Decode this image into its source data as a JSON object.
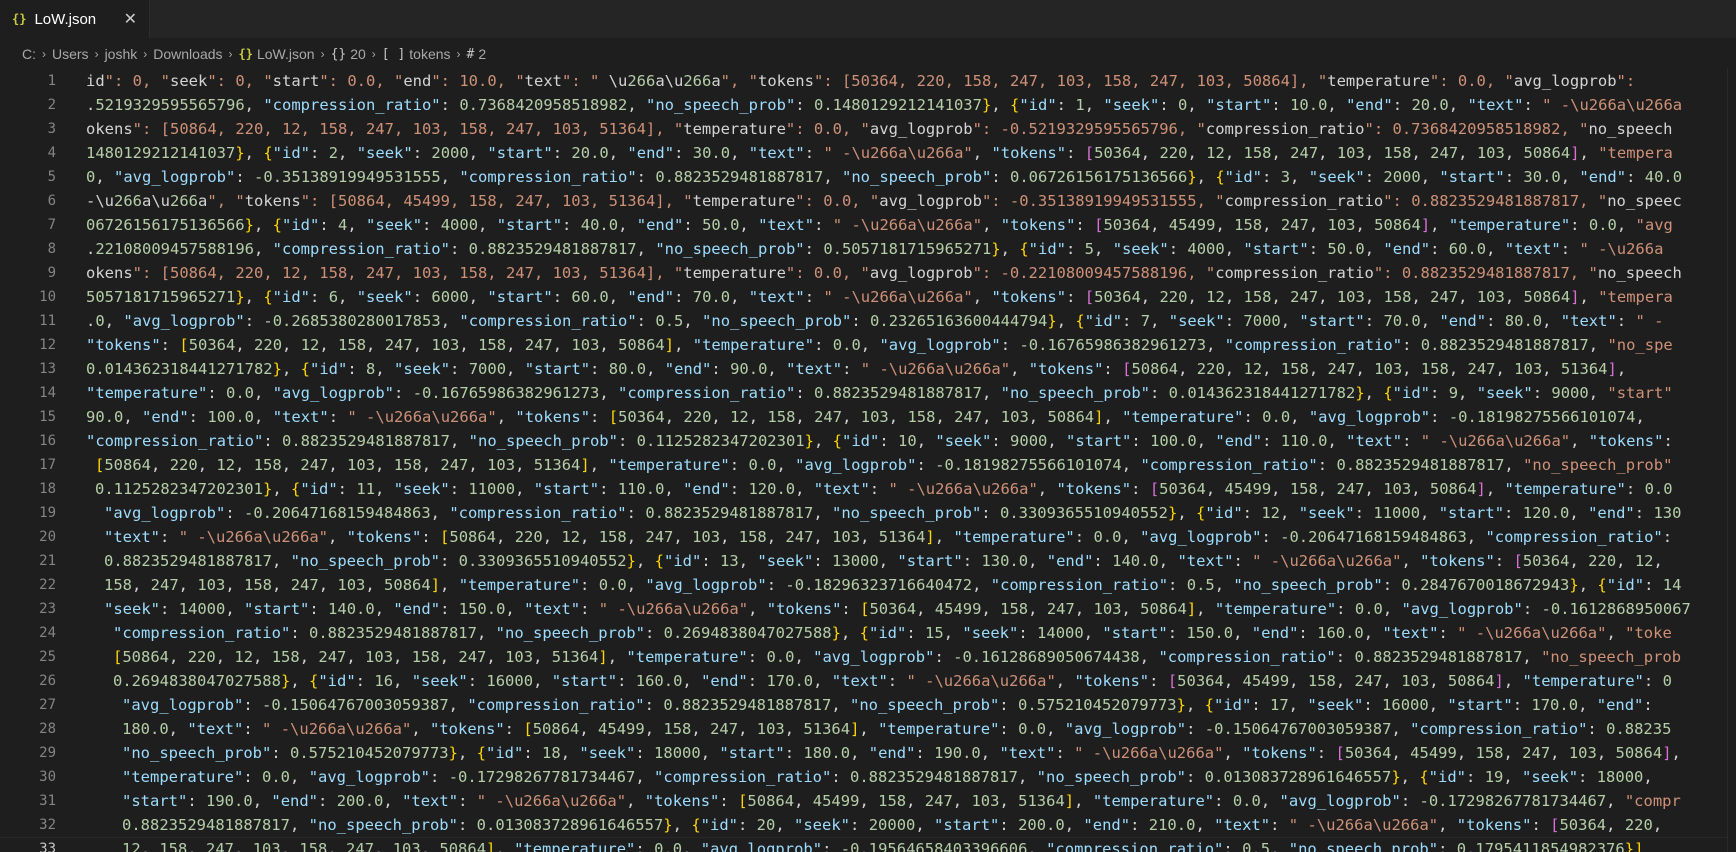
{
  "tab": {
    "label": "LoW.json",
    "icon": "json-braces-icon",
    "close_glyph": "✕"
  },
  "breadcrumb": [
    {
      "label": "C:"
    },
    {
      "label": "Users"
    },
    {
      "label": "joshk"
    },
    {
      "label": "Downloads"
    },
    {
      "label": "LoW.json",
      "icon": "{}"
    },
    {
      "label": "20",
      "icon": "{}"
    },
    {
      "label": "tokens",
      "icon": "[ ]"
    },
    {
      "label": "2",
      "icon": "#"
    }
  ],
  "colors": {
    "key": "#9cdcfe",
    "string": "#ce9178",
    "number": "#b5cea8",
    "bracket1": "#ffd700",
    "bracket2": "#da70d6",
    "bracket3": "#179fff"
  },
  "active_line": 33,
  "lines": [
    {
      "n": "1",
      "i": 0,
      "t": "id\": 0, \"seek\": 0, \"start\": 0.0, \"end\": 10.0, \"text\": \" \\u266a\\u266a\", \"tokens\": [50364, 220, 158, 247, 103, 158, 247, 103, 50864], \"temperature\": 0.0, \"avg_logprob\":"
    },
    {
      "n": "2",
      "i": 0,
      "t": ".5219329595565796, \"compression_ratio\": 0.7368420958518982, \"no_speech_prob\": 0.1480129212141037}, {\"id\": 1, \"seek\": 0, \"start\": 10.0, \"end\": 20.0, \"text\": \" -\\u266a\\u266a"
    },
    {
      "n": "3",
      "i": 0,
      "t": "okens\": [50864, 220, 12, 158, 247, 103, 158, 247, 103, 51364], \"temperature\": 0.0, \"avg_logprob\": -0.5219329595565796, \"compression_ratio\": 0.7368420958518982, \"no_speech"
    },
    {
      "n": "4",
      "i": 0,
      "t": "1480129212141037}, {\"id\": 2, \"seek\": 2000, \"start\": 20.0, \"end\": 30.0, \"text\": \" -\\u266a\\u266a\", \"tokens\": [50364, 220, 12, 158, 247, 103, 158, 247, 103, 50864], \"tempera"
    },
    {
      "n": "5",
      "i": 0,
      "t": "0, \"avg_logprob\": -0.35138919949531555, \"compression_ratio\": 0.8823529481887817, \"no_speech_prob\": 0.06726156175136566}, {\"id\": 3, \"seek\": 2000, \"start\": 30.0, \"end\": 40.0"
    },
    {
      "n": "6",
      "i": 0,
      "t": "-\\u266a\\u266a\", \"tokens\": [50864, 45499, 158, 247, 103, 51364], \"temperature\": 0.0, \"avg_logprob\": -0.35138919949531555, \"compression_ratio\": 0.8823529481887817, \"no_speec"
    },
    {
      "n": "7",
      "i": 0,
      "t": "06726156175136566}, {\"id\": 4, \"seek\": 4000, \"start\": 40.0, \"end\": 50.0, \"text\": \" -\\u266a\\u266a\", \"tokens\": [50364, 45499, 158, 247, 103, 50864], \"temperature\": 0.0, \"avg"
    },
    {
      "n": "8",
      "i": 0,
      "t": ".22108009457588196, \"compression_ratio\": 0.8823529481887817, \"no_speech_prob\": 0.5057181715965271}, {\"id\": 5, \"seek\": 4000, \"start\": 50.0, \"end\": 60.0, \"text\": \" -\\u266a"
    },
    {
      "n": "9",
      "i": 0,
      "t": "okens\": [50864, 220, 12, 158, 247, 103, 158, 247, 103, 51364], \"temperature\": 0.0, \"avg_logprob\": -0.22108009457588196, \"compression_ratio\": 0.8823529481887817, \"no_speech"
    },
    {
      "n": "10",
      "i": 0,
      "t": "5057181715965271}, {\"id\": 6, \"seek\": 6000, \"start\": 60.0, \"end\": 70.0, \"text\": \" -\\u266a\\u266a\", \"tokens\": [50364, 220, 12, 158, 247, 103, 158, 247, 103, 50864], \"tempera"
    },
    {
      "n": "11",
      "i": 0,
      "t": ".0, \"avg_logprob\": -0.2685380280017853, \"compression_ratio\": 0.5, \"no_speech_prob\": 0.23265163600444794}, {\"id\": 7, \"seek\": 7000, \"start\": 70.0, \"end\": 80.0, \"text\": \" -"
    },
    {
      "n": "12",
      "i": 0,
      "t": "\"tokens\": [50364, 220, 12, 158, 247, 103, 158, 247, 103, 50864], \"temperature\": 0.0, \"avg_logprob\": -0.16765986382961273, \"compression_ratio\": 0.8823529481887817, \"no_spe"
    },
    {
      "n": "13",
      "i": 0,
      "t": "0.014362318441271782}, {\"id\": 8, \"seek\": 7000, \"start\": 80.0, \"end\": 90.0, \"text\": \" -\\u266a\\u266a\", \"tokens\": [50864, 220, 12, 158, 247, 103, 158, 247, 103, 51364],"
    },
    {
      "n": "14",
      "i": 0,
      "t": "\"temperature\": 0.0, \"avg_logprob\": -0.16765986382961273, \"compression_ratio\": 0.8823529481887817, \"no_speech_prob\": 0.014362318441271782}, {\"id\": 9, \"seek\": 9000, \"start\""
    },
    {
      "n": "15",
      "i": 0,
      "t": "90.0, \"end\": 100.0, \"text\": \" -\\u266a\\u266a\", \"tokens\": [50364, 220, 12, 158, 247, 103, 158, 247, 103, 50864], \"temperature\": 0.0, \"avg_logprob\": -0.18198275566101074,"
    },
    {
      "n": "16",
      "i": 0,
      "t": "\"compression_ratio\": 0.8823529481887817, \"no_speech_prob\": 0.1125282347202301}, {\"id\": 10, \"seek\": 9000, \"start\": 100.0, \"end\": 110.0, \"text\": \" -\\u266a\\u266a\", \"tokens\":"
    },
    {
      "n": "17",
      "i": 1,
      "t": "[50864, 220, 12, 158, 247, 103, 158, 247, 103, 51364], \"temperature\": 0.0, \"avg_logprob\": -0.18198275566101074, \"compression_ratio\": 0.8823529481887817, \"no_speech_prob\""
    },
    {
      "n": "18",
      "i": 1,
      "t": "0.1125282347202301}, {\"id\": 11, \"seek\": 11000, \"start\": 110.0, \"end\": 120.0, \"text\": \" -\\u266a\\u266a\", \"tokens\": [50364, 45499, 158, 247, 103, 50864], \"temperature\": 0.0"
    },
    {
      "n": "19",
      "i": 2,
      "t": "\"avg_logprob\": -0.20647168159484863, \"compression_ratio\": 0.8823529481887817, \"no_speech_prob\": 0.3309365510940552}, {\"id\": 12, \"seek\": 11000, \"start\": 120.0, \"end\": 130"
    },
    {
      "n": "20",
      "i": 2,
      "t": "\"text\": \" -\\u266a\\u266a\", \"tokens\": [50864, 220, 12, 158, 247, 103, 158, 247, 103, 51364], \"temperature\": 0.0, \"avg_logprob\": -0.20647168159484863, \"compression_ratio\":"
    },
    {
      "n": "21",
      "i": 2,
      "t": "0.8823529481887817, \"no_speech_prob\": 0.3309365510940552}, {\"id\": 13, \"seek\": 13000, \"start\": 130.0, \"end\": 140.0, \"text\": \" -\\u266a\\u266a\", \"tokens\": [50364, 220, 12,"
    },
    {
      "n": "22",
      "i": 2,
      "t": "158, 247, 103, 158, 247, 103, 50864], \"temperature\": 0.0, \"avg_logprob\": -0.18296323716640472, \"compression_ratio\": 0.5, \"no_speech_prob\": 0.2847670018672943}, {\"id\": 14"
    },
    {
      "n": "23",
      "i": 2,
      "t": "\"seek\": 14000, \"start\": 140.0, \"end\": 150.0, \"text\": \" -\\u266a\\u266a\", \"tokens\": [50364, 45499, 158, 247, 103, 50864], \"temperature\": 0.0, \"avg_logprob\": -0.1612868950067"
    },
    {
      "n": "24",
      "i": 3,
      "t": "\"compression_ratio\": 0.8823529481887817, \"no_speech_prob\": 0.2694838047027588}, {\"id\": 15, \"seek\": 14000, \"start\": 150.0, \"end\": 160.0, \"text\": \" -\\u266a\\u266a\", \"toke"
    },
    {
      "n": "25",
      "i": 3,
      "t": "[50864, 220, 12, 158, 247, 103, 158, 247, 103, 51364], \"temperature\": 0.0, \"avg_logprob\": -0.16128689050674438, \"compression_ratio\": 0.8823529481887817, \"no_speech_prob"
    },
    {
      "n": "26",
      "i": 3,
      "t": "0.2694838047027588}, {\"id\": 16, \"seek\": 16000, \"start\": 160.0, \"end\": 170.0, \"text\": \" -\\u266a\\u266a\", \"tokens\": [50364, 45499, 158, 247, 103, 50864], \"temperature\": 0"
    },
    {
      "n": "27",
      "i": 4,
      "t": "\"avg_logprob\": -0.15064767003059387, \"compression_ratio\": 0.8823529481887817, \"no_speech_prob\": 0.575210452079773}, {\"id\": 17, \"seek\": 16000, \"start\": 170.0, \"end\":"
    },
    {
      "n": "28",
      "i": 4,
      "t": "180.0, \"text\": \" -\\u266a\\u266a\", \"tokens\": [50864, 45499, 158, 247, 103, 51364], \"temperature\": 0.0, \"avg_logprob\": -0.15064767003059387, \"compression_ratio\": 0.88235"
    },
    {
      "n": "29",
      "i": 4,
      "t": "\"no_speech_prob\": 0.575210452079773}, {\"id\": 18, \"seek\": 18000, \"start\": 180.0, \"end\": 190.0, \"text\": \" -\\u266a\\u266a\", \"tokens\": [50364, 45499, 158, 247, 103, 50864],"
    },
    {
      "n": "30",
      "i": 4,
      "t": "\"temperature\": 0.0, \"avg_logprob\": -0.17298267781734467, \"compression_ratio\": 0.8823529481887817, \"no_speech_prob\": 0.013083728961646557}, {\"id\": 19, \"seek\": 18000,"
    },
    {
      "n": "31",
      "i": 4,
      "t": "\"start\": 190.0, \"end\": 200.0, \"text\": \" -\\u266a\\u266a\", \"tokens\": [50864, 45499, 158, 247, 103, 51364], \"temperature\": 0.0, \"avg_logprob\": -0.17298267781734467, \"compr"
    },
    {
      "n": "32",
      "i": 4,
      "t": "0.8823529481887817, \"no_speech_prob\": 0.013083728961646557}, {\"id\": 20, \"seek\": 20000, \"start\": 200.0, \"end\": 210.0, \"text\": \" -\\u266a\\u266a\", \"tokens\": [50364, 220,"
    },
    {
      "n": "33",
      "i": 4,
      "t": "12, 158, 247, 103, 158, 247, 103, 50864], \"temperature\": 0.0, \"avg_logprob\": -0.19564658403396606, \"compression_ratio\": 0.5, \"no_speech_prob\": 0.1795411854982376}]"
    }
  ]
}
